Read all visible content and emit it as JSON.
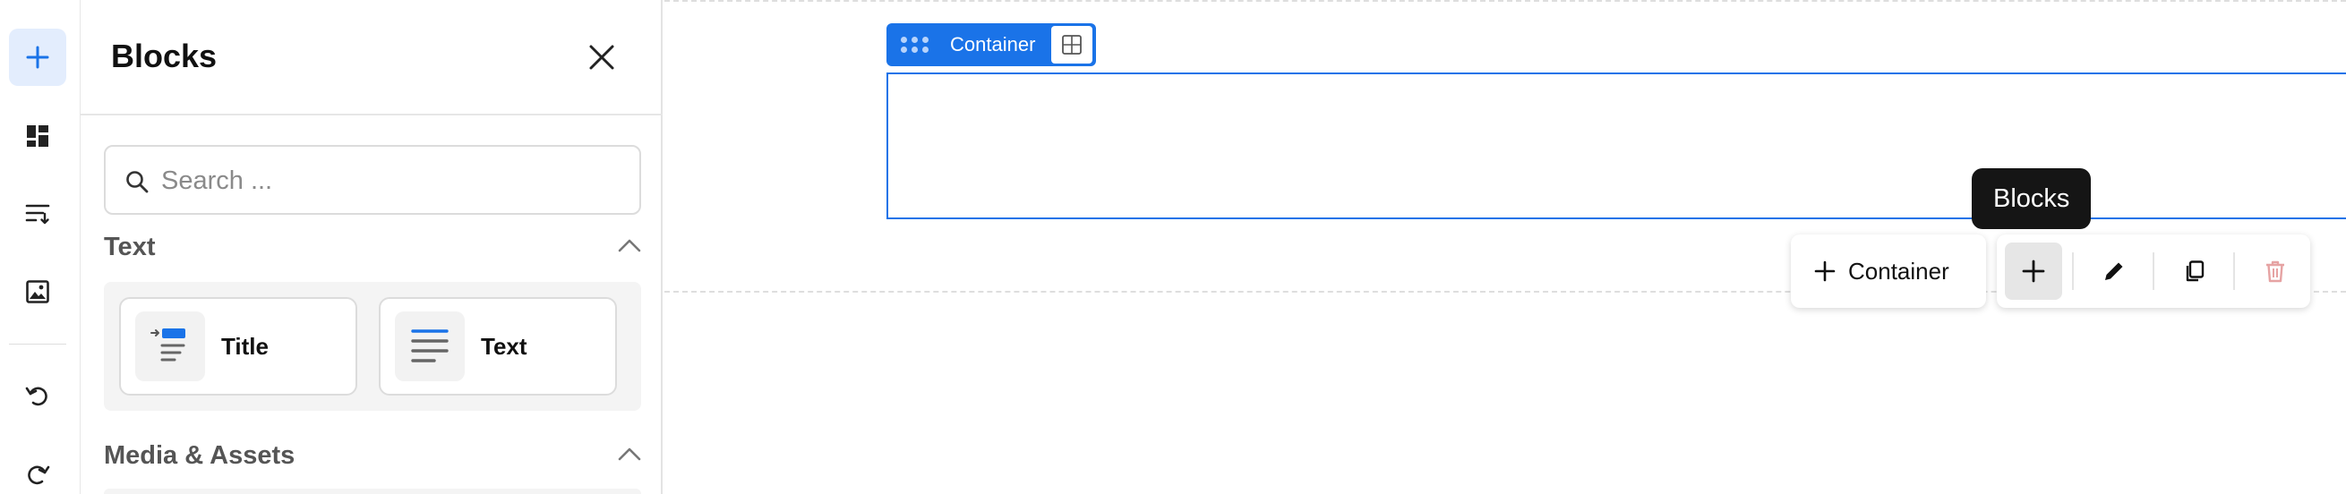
{
  "toolbar": {
    "items": [
      {
        "name": "add",
        "icon": "plus-icon",
        "active": true
      },
      {
        "name": "layout",
        "icon": "dashboard-icon"
      },
      {
        "name": "sort",
        "icon": "sort-icon"
      },
      {
        "name": "media",
        "icon": "image-icon"
      },
      {
        "name": "undo",
        "icon": "undo-icon"
      },
      {
        "name": "redo",
        "icon": "redo-icon"
      }
    ]
  },
  "panel": {
    "title": "Blocks",
    "search_placeholder": "Search ...",
    "sections": [
      {
        "title": "Text",
        "expanded": true,
        "blocks": [
          {
            "label": "Title",
            "icon": "title-block-icon"
          },
          {
            "label": "Text",
            "icon": "text-block-icon"
          }
        ]
      },
      {
        "title": "Media & Assets",
        "expanded": true
      }
    ]
  },
  "canvas": {
    "container_label": "Container",
    "tooltip": "Blocks",
    "add_container_label": "Container",
    "actions": [
      {
        "name": "add-blocks",
        "icon": "plus-icon",
        "active": true
      },
      {
        "name": "edit",
        "icon": "pencil-icon"
      },
      {
        "name": "duplicate",
        "icon": "copy-icon"
      },
      {
        "name": "delete",
        "icon": "trash-icon"
      }
    ]
  },
  "colors": {
    "accent": "#1a73e8",
    "active_bg": "#e3edfd",
    "danger": "#e6a3a3",
    "tooltip_bg": "#151515"
  }
}
